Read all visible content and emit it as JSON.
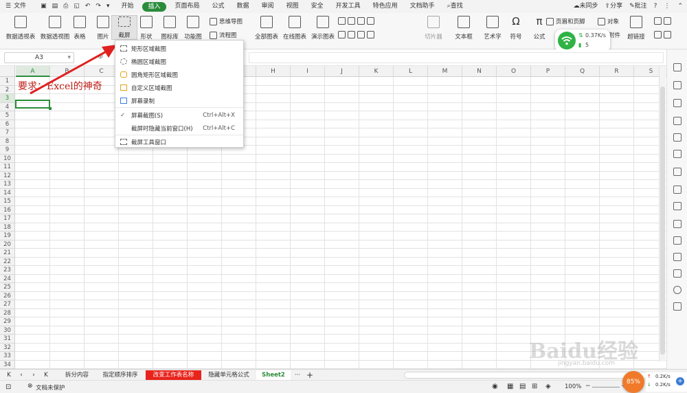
{
  "menubar": {
    "file": "文件",
    "tabs": [
      "开始",
      "插入",
      "页面布局",
      "公式",
      "数据",
      "审阅",
      "视图",
      "安全",
      "开发工具",
      "特色应用",
      "文档助手"
    ],
    "active_tab": "插入",
    "search": "查找",
    "sync": "未同步",
    "share": "分享",
    "comment": "批注"
  },
  "ribbon": {
    "pivot_table": "数据透视表",
    "pivot_chart": "数据透视图",
    "table": "表格",
    "picture": "图片",
    "screenshot": "截屏",
    "shape": "形状",
    "icon_lib": "图标库",
    "function_map": "功能图",
    "mindmap": "思维导图",
    "flowchart": "流程图",
    "all_charts": "全部图表",
    "online_charts": "在线图表",
    "demo_charts": "演示图表",
    "slicer": "切片器",
    "textbox": "文本框",
    "wordart": "艺术字",
    "symbol": "符号",
    "formula": "公式",
    "header_footer": "页眉和页脚",
    "object": "对象",
    "attachment": "附件",
    "hyperlink": "超链接"
  },
  "namebox": "A3",
  "network": {
    "speed": "0.37K/s",
    "count": "5"
  },
  "grid": {
    "columns": [
      "A",
      "B",
      "C",
      "D",
      "E",
      "F",
      "G",
      "H",
      "I",
      "J",
      "K",
      "L",
      "M",
      "N",
      "O",
      "P",
      "Q",
      "R",
      "S"
    ],
    "rows": [
      "1",
      "2",
      "3",
      "4",
      "5",
      "6",
      "7",
      "8",
      "9",
      "10",
      "11",
      "12",
      "13",
      "14",
      "15",
      "16",
      "17",
      "18",
      "19",
      "20",
      "21",
      "22",
      "23",
      "24",
      "25",
      "26",
      "27",
      "28",
      "29",
      "30",
      "31",
      "32",
      "33",
      "34"
    ],
    "a1_text": "要求：Excel的神奇"
  },
  "dropdown": {
    "items": [
      {
        "label": "矩形区域截图",
        "shortcut": ""
      },
      {
        "label": "椭圆区域截图",
        "shortcut": ""
      },
      {
        "label": "圆角矩形区域截图",
        "shortcut": ""
      },
      {
        "label": "自定义区域截图",
        "shortcut": ""
      },
      {
        "label": "屏幕录制",
        "shortcut": ""
      },
      {
        "label": "屏幕截图(S)",
        "shortcut": "Ctrl+Alt+X"
      },
      {
        "label": "截屏时隐藏当前窗口(H)",
        "shortcut": "Ctrl+Alt+C"
      },
      {
        "label": "截屏工具窗口",
        "shortcut": ""
      }
    ]
  },
  "sheets": {
    "tabs": [
      "拆分内容",
      "指定顺序排序",
      "改变工作表名称",
      "隐藏单元格公式",
      "Sheet2"
    ],
    "highlighted": "改变工作表名称",
    "active": "Sheet2",
    "more": "···",
    "add": "+"
  },
  "status": {
    "doc_state": "文档未保护",
    "zoom": "100%",
    "cpu": "85%",
    "up_speed": "0.2K/s",
    "down_speed": "0.2K/s"
  },
  "watermark": {
    "logo": "Baidu经验",
    "url": "jingyan.baidu.com"
  },
  "colors": {
    "accent_green": "#2a8c3a",
    "arrow_red": "#e02020",
    "tab_red": "#e8231c"
  }
}
